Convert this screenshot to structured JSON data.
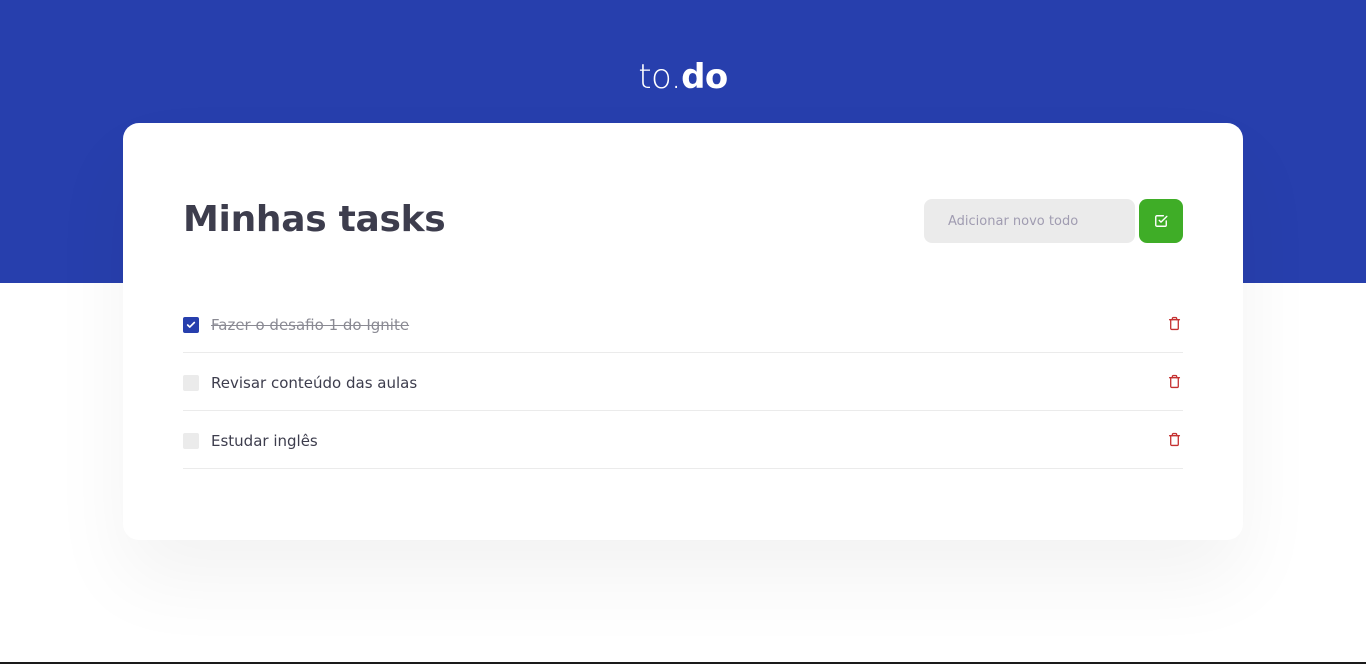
{
  "app": {
    "logo_light": "to.",
    "logo_bold": "do"
  },
  "main": {
    "title": "Minhas tasks",
    "new_todo": {
      "value": "",
      "placeholder": "Adicionar novo todo",
      "add_icon": "check-square-icon"
    },
    "tasks": [
      {
        "text": "Fazer o desafio 1 do Ignite",
        "done": true,
        "delete_icon": "trash-icon"
      },
      {
        "text": "Revisar conteúdo das aulas",
        "done": false,
        "delete_icon": "trash-icon"
      },
      {
        "text": "Estudar inglês",
        "done": false,
        "delete_icon": "trash-icon"
      }
    ]
  },
  "colors": {
    "primary": "#273fad",
    "success": "#3fad27",
    "danger": "#c53030",
    "title_text": "#3d3d4d",
    "input_bg": "#ebebeb"
  }
}
